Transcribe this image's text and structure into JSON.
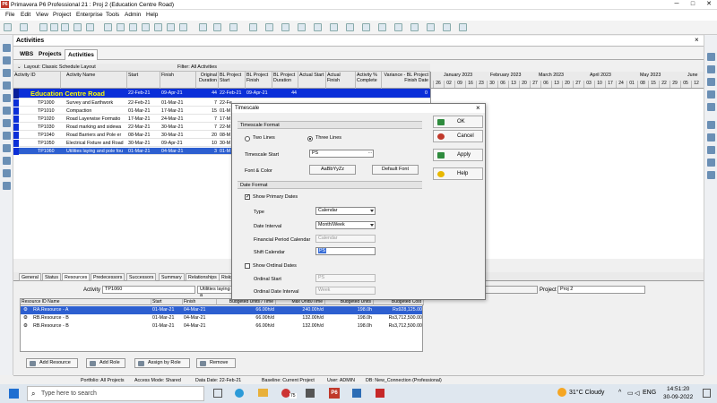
{
  "window": {
    "title": "Primavera P6 Professional 21 : Proj 2 (Education Centre Road)",
    "app_icon_text": "P6",
    "minimize": "─",
    "maximize": "□",
    "close": "✕"
  },
  "menu": [
    "File",
    "Edit",
    "View",
    "Project",
    "Enterprise",
    "Tools",
    "Admin",
    "Help"
  ],
  "activities_header": {
    "title": "Activities",
    "close": "×"
  },
  "tabs": [
    "WBS",
    "Projects",
    "Activities"
  ],
  "layout": {
    "label": "Layout: Classic Schedule Layout",
    "filter": "Filter: All Activities"
  },
  "columns": [
    "Activity ID",
    "Activity Name",
    "Start",
    "Finish",
    "Original Duration",
    "BL Project Start",
    "BL Project Finish",
    "BL Project Duration",
    "Actual Start",
    "Actual Finish",
    "Activity % Complete",
    "Variance - BL Project Finish Date"
  ],
  "wbs_row": {
    "id": "Education Centre Road",
    "start": "22-Feb-21",
    "finish": "09-Apr-21",
    "dur": "44",
    "bl_start": "22-Feb-21",
    "bl_finish": "09-Apr-21",
    "bl_dur": "44",
    "var": "0"
  },
  "rows": [
    {
      "id": "TP1000",
      "name": "Survey and Earthwork",
      "start": "22-Feb-21",
      "finish": "01-Mar-21",
      "dur": "7",
      "bl": "22-Fe"
    },
    {
      "id": "TP1010",
      "name": "Compaction",
      "start": "01-Mar-21",
      "finish": "17-Mar-21",
      "dur": "15",
      "bl": "01-M"
    },
    {
      "id": "TP1020",
      "name": "Road Layerwise Formatio",
      "start": "17-Mar-21",
      "finish": "24-Mar-21",
      "dur": "7",
      "bl": "17-M"
    },
    {
      "id": "TP1030",
      "name": "Road marking and sidewa",
      "start": "22-Mar-21",
      "finish": "30-Mar-21",
      "dur": "7",
      "bl": "22-M"
    },
    {
      "id": "TP1040",
      "name": "Road Barriers and Pole er",
      "start": "08-Mar-21",
      "finish": "30-Mar-21",
      "dur": "20",
      "bl": "08-M"
    },
    {
      "id": "TP1050",
      "name": "Electrical Fixture and Road",
      "start": "30-Mar-21",
      "finish": "09-Apr-21",
      "dur": "10",
      "bl": "30-M"
    },
    {
      "id": "TP1060",
      "name": "Utilities laying and pole fou",
      "start": "01-Mar-21",
      "finish": "04-Mar-21",
      "dur": "3",
      "bl": "01-M"
    }
  ],
  "gantt": {
    "months": [
      "January 2023",
      "February 2023",
      "March 2023",
      "April 2023",
      "May 2023",
      "June"
    ],
    "days": [
      "26",
      "02",
      "09",
      "16",
      "23",
      "30",
      "06",
      "13",
      "20",
      "27",
      "06",
      "13",
      "20",
      "27",
      "03",
      "10",
      "17",
      "24",
      "01",
      "08",
      "15",
      "22",
      "29",
      "05",
      "12"
    ]
  },
  "bottom_tabs": [
    "General",
    "Status",
    "Resources",
    "Predecessors",
    "Successors",
    "Summary",
    "Relationships",
    "Risks"
  ],
  "bottom": {
    "activity_label": "Activity",
    "activity_id": "TP1060",
    "activity_name": "Utilities laying a",
    "project_label": "Project",
    "project_value": "Proj 2",
    "res_headers": [
      "Resource ID Name",
      "Start",
      "Finish",
      "Budgeted Units / Time",
      "Max Units/Time",
      "Budgeted Units",
      "Budgeted Cost"
    ],
    "resources": [
      {
        "name": "RA.Resource - A",
        "start": "01-Mar-21",
        "finish": "04-Mar-21",
        "upt": "66.00h/d",
        "max": "240.00h/d",
        "units": "198.0h",
        "cost": "Rs928,125.00"
      },
      {
        "name": "RB.Resource - B",
        "start": "01-Mar-21",
        "finish": "04-Mar-21",
        "upt": "66.00h/d",
        "max": "132.00h/d",
        "units": "198.0h",
        "cost": "Rs3,712,500.00"
      },
      {
        "name": "RB.Resource - B",
        "start": "01-Mar-21",
        "finish": "04-Mar-21",
        "upt": "66.00h/d",
        "max": "132.00h/d",
        "units": "198.0h",
        "cost": "Rs3,712,500.00"
      }
    ],
    "buttons": [
      "Add Resource",
      "Add Role",
      "Assign by Role",
      "Remove"
    ]
  },
  "status": {
    "portfolio": "Portfolio: All Projects",
    "access": "Access Mode: Shared",
    "data_date": "Data Date: 22-Feb-21",
    "baseline": "Baseline: Current Project",
    "user": "User: ADMIN",
    "db": "DB: New_Connection (Professional)"
  },
  "dialog": {
    "title": "Timescale",
    "close": "×",
    "section_format": "Timescale Format",
    "two_lines": "Two Lines",
    "three_lines": "Three Lines",
    "timescale_start_label": "Timescale Start",
    "timescale_start_value": "PS",
    "font_color_label": "Font & Color",
    "font_sample": "AaBbYyZz",
    "default_font": "Default Font",
    "section_date": "Date Format",
    "show_primary": "Show Primary Dates",
    "type_label": "Type",
    "type_value": "Calendar",
    "interval_label": "Date Interval",
    "interval_value": "Month/Week",
    "fin_label": "Financial Period Calendar",
    "fin_value": "Calendar",
    "shift_label": "Shift Calendar",
    "shift_value": "PS",
    "show_ordinal": "Show Ordinal Dates",
    "ord_start_label": "Ordinal Start",
    "ord_start_value": "PS",
    "ord_interval_label": "Ordinal Date Interval",
    "ord_interval_value": "Week",
    "ok": "OK",
    "cancel": "Cancel",
    "apply": "Apply",
    "help": "Help"
  },
  "taskbar": {
    "search_placeholder": "Type here to search",
    "weather": "31°C  Cloudy",
    "lang": "ENG",
    "time": "14:51:20",
    "date": "30-09-2022",
    "badge": "75"
  },
  "colors": {
    "wbs_blue": "#0b2fd8",
    "selection": "#2d5fd0",
    "wbs_text": "#ffff00"
  }
}
